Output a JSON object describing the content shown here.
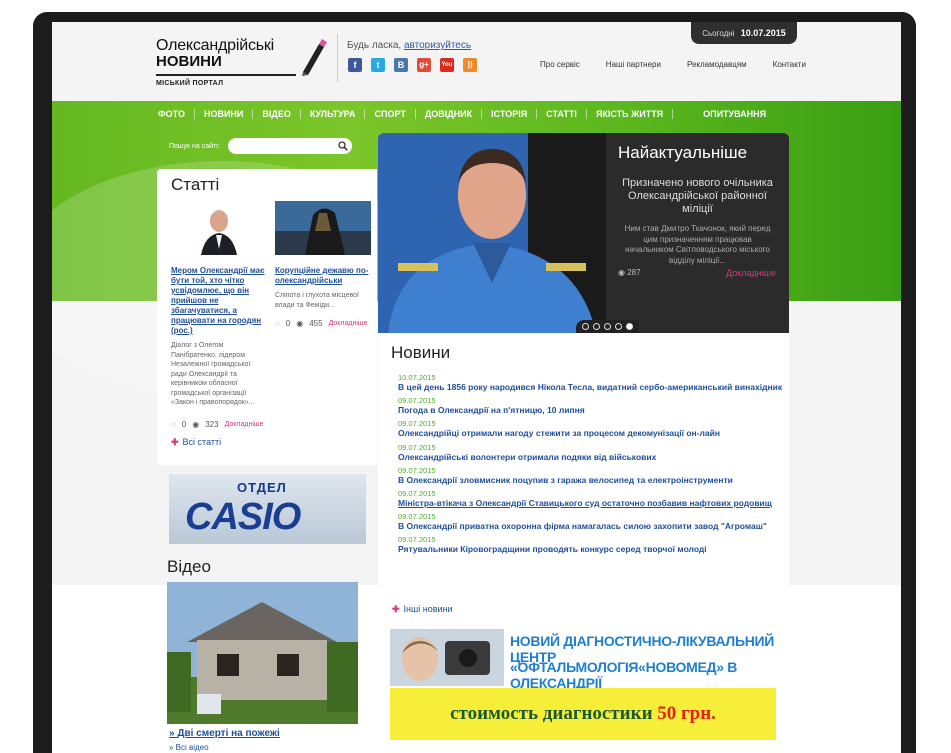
{
  "header": {
    "logo_line1": "Олександрійські",
    "logo_line2": "НОВИНИ",
    "logo_line3": "МІСЬКИЙ ПОРТАЛ",
    "login_prefix": "Будь ласка,",
    "login_link": "авторизуйтесь",
    "social": [
      {
        "icon": "facebook-icon",
        "glyph": "f",
        "color": "#3b5998"
      },
      {
        "icon": "twitter-icon",
        "glyph": "t",
        "color": "#29a9e1"
      },
      {
        "icon": "vk-icon",
        "glyph": "B",
        "color": "#4a76a8"
      },
      {
        "icon": "google-plus-icon",
        "glyph": "g+",
        "color": "#dd4b39"
      },
      {
        "icon": "youtube-icon",
        "glyph": "You",
        "color": "#d92b1f"
      },
      {
        "icon": "rss-icon",
        "glyph": "))",
        "color": "#f2882a"
      }
    ],
    "topnav": [
      "Про сервіс",
      "Наші партнери",
      "Рекламодавцям",
      "Контакти"
    ],
    "date_label": "Сьогодні",
    "date_value": "10.07.2015"
  },
  "mainnav": [
    "ФОТО",
    "НОВИНИ",
    "ВІДЕО",
    "КУЛЬТУРА",
    "СПОРТ",
    "ДОВІДНИК",
    "ІСТОРІЯ",
    "СТАТТІ",
    "ЯКІСТЬ ЖИТТЯ",
    "ОПИТУВАННЯ"
  ],
  "search": {
    "label": "Пошук на сайті:",
    "placeholder": ""
  },
  "articles": {
    "heading": "Статті",
    "items": [
      {
        "title": "Мером Олександрії має бути той, хто чітко усвідомлює, що він прийшов не збагачуватися, а працювати на городян (рос.)",
        "text": "Діалог з Олегом Панібратенко, лідером Незалежної громадської ради Олександрії та керівником обласної громадської організації «Закон і правопорядок»...",
        "comments": "0",
        "views": "323",
        "more": "Докладніше"
      },
      {
        "title": "Корупційне дежавю по-олександрійськи",
        "text": "Сліпота і глухота місцевої влади та Феміди...",
        "comments": "0",
        "views": "455",
        "more": "Докладніше"
      }
    ],
    "all_link": "Всі статті"
  },
  "casio": {
    "line1": "ОТДЕЛ",
    "line2": "CASIO"
  },
  "featured": {
    "heading": "Найактуальніше",
    "title": "Призначено нового очільника Олександрійської районної міліції",
    "text": "Ним став Дмитро Ткачонок, який перед цим призначенням працював начальником Світловодського міського відділу міліції...",
    "views": "287",
    "more": "Докладніше",
    "slides_total": 5,
    "slide_active": 5
  },
  "news": {
    "heading": "Новини",
    "items": [
      {
        "date": "10.07.2015",
        "title": "В цей день 1856 року народився Нікола Тесла, видатний сербо-американський винахідник",
        "underline": false
      },
      {
        "date": "09.07.2015",
        "title": "Погода в Олександрії на п'ятницю, 10 липня",
        "underline": false
      },
      {
        "date": "09.07.2015",
        "title": "Олександрійці отримали нагоду стежити за процесом декомунізації он-лайн",
        "underline": false
      },
      {
        "date": "09.07.2015",
        "title": "Олександрійські волонтери отримали подяки від військових",
        "underline": false
      },
      {
        "date": "09.07.2015",
        "title": "В Олександрії зловмисник поцупив з гаража велосипед та електроінструменти",
        "underline": false
      },
      {
        "date": "09.07.2015",
        "title": "Міністра-втікача з Олександрії Ставицького суд остаточно позбавив нафтових родовищ",
        "underline": true
      },
      {
        "date": "09.07.2015",
        "title": "В Олександрії приватна охоронна фірма намагалась силою захопити завод \"Агромаш\"",
        "underline": false
      },
      {
        "date": "09.07.2015",
        "title": "Рятувальники Кіровоградщини проводять конкурс серед творчої молоді",
        "underline": false
      }
    ],
    "other_link": "Інші новини"
  },
  "video": {
    "heading": "Відео",
    "caption": "Дві смерті на пожежі",
    "all_link": "Всі відео"
  },
  "ad": {
    "line1": "НОВИЙ ДІАГНОСТИЧНО-ЛІКУВАЛЬНИЙ ЦЕНТР",
    "line2": "«ОФТАЛЬМОЛОГІЯ«НОВОМЕД» В ОЛЕКСАНДРІЇ",
    "line3": "стоимость диагностики",
    "price": "50 грн."
  }
}
